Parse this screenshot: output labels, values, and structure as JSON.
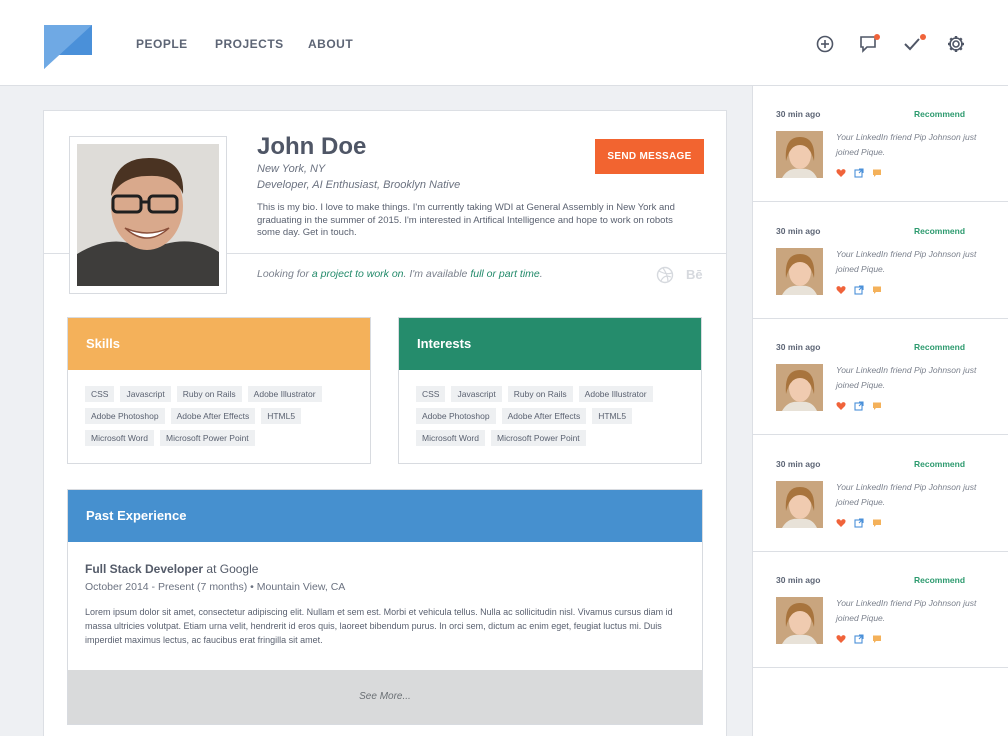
{
  "nav": {
    "links": [
      "PEOPLE",
      "PROJECTS",
      "ABOUT"
    ],
    "icons": [
      "add-circle-icon",
      "chat-bubble-icon",
      "checkmark-icon",
      "gear-icon"
    ]
  },
  "profile": {
    "name": "John Doe",
    "location": "New York, NY",
    "tagline": "Developer, AI Enthusiast, Brooklyn Native",
    "bio": "This is my bio. I love to make things. I'm currently taking WDI at General Assembly in New York and graduating in the summer of 2015. I'm interested in Artifical Intelligence and hope to work on robots some day. Get in touch.",
    "send_label": "SEND MESSAGE",
    "availability": {
      "prefix": "Looking for",
      "link1": "a project to work on",
      "middle": ". I'm available",
      "link2": "full or part time",
      "suffix": "."
    },
    "behance_label": "Bē"
  },
  "skills": {
    "title": "Skills",
    "tags": [
      "CSS",
      "Javascript",
      "Ruby on Rails",
      "Adobe Illustrator",
      "Adobe Photoshop",
      "Adobe After Effects",
      "HTML5",
      "Microsoft Word",
      "Microsoft Power Point"
    ]
  },
  "interests": {
    "title": "Interests",
    "tags": [
      "CSS",
      "Javascript",
      "Ruby on Rails",
      "Adobe Illustrator",
      "Adobe Photoshop",
      "Adobe After Effects",
      "HTML5",
      "Microsoft Word",
      "Microsoft Power Point"
    ]
  },
  "experience": {
    "title": "Past Experience",
    "role": "Full Stack Developer",
    "company": "at Google",
    "dates": "October 2014 - Present (7 months)  •  Mountain View, CA",
    "description": "Lorem ipsum dolor sit amet, consectetur adipiscing elit. Nullam et sem est. Morbi et vehicula tellus. Nulla ac sollicitudin nisl. Vivamus cursus diam id massa ultricies volutpat. Etiam urna velit, hendrerit id eros quis, laoreet bibendum purus. In orci sem, dictum ac enim eget, feugiat luctus mi. Duis imperdiet maximus lectus, ac faucibus erat fringilla sit amet.",
    "see_more": "See More..."
  },
  "feed": [
    {
      "time": "30 min ago",
      "action": "Recommend",
      "text": "Your LinkedIn friend Pip Johnson just joined Pique."
    },
    {
      "time": "30 min ago",
      "action": "Recommend",
      "text": "Your LinkedIn friend Pip Johnson just joined Pique."
    },
    {
      "time": "30 min ago",
      "action": "Recommend",
      "text": "Your LinkedIn friend Pip Johnson just joined Pique."
    },
    {
      "time": "30 min ago",
      "action": "Recommend",
      "text": "Your LinkedIn friend Pip Johnson just joined Pique."
    },
    {
      "time": "30 min ago",
      "action": "Recommend",
      "text": "Your LinkedIn friend Pip Johnson just joined Pique."
    }
  ],
  "colors": {
    "accent_orange": "#f26430",
    "skills_yellow": "#f4b15a",
    "interests_green": "#258c6c",
    "experience_blue": "#4690cf",
    "logo_blue": "#4a90d9"
  }
}
